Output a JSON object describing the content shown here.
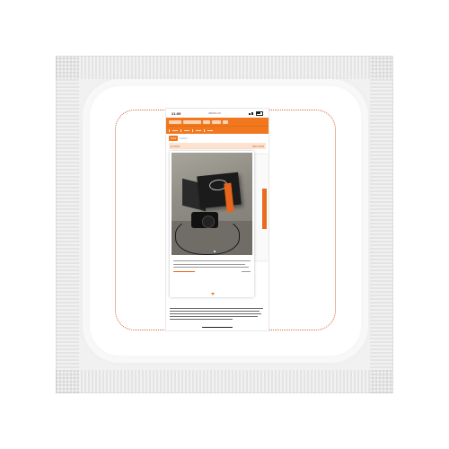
{
  "status_bar": {
    "time": "21:05",
    "url": "aukro.cz"
  },
  "nav": {
    "tabs": [
      "•••••",
      "•••••••"
    ],
    "filter_left": "•• ••••••",
    "filter_right": "••••• ••••••"
  },
  "colors": {
    "accent": "#f1781f",
    "packet": "#f1f1f1",
    "dotted_border": "#d9653e"
  },
  "icons": [
    "signal-icon",
    "wifi-icon",
    "battery-icon",
    "chevron-down-icon"
  ],
  "photo": {
    "subject": "camera-in-box-photo"
  }
}
